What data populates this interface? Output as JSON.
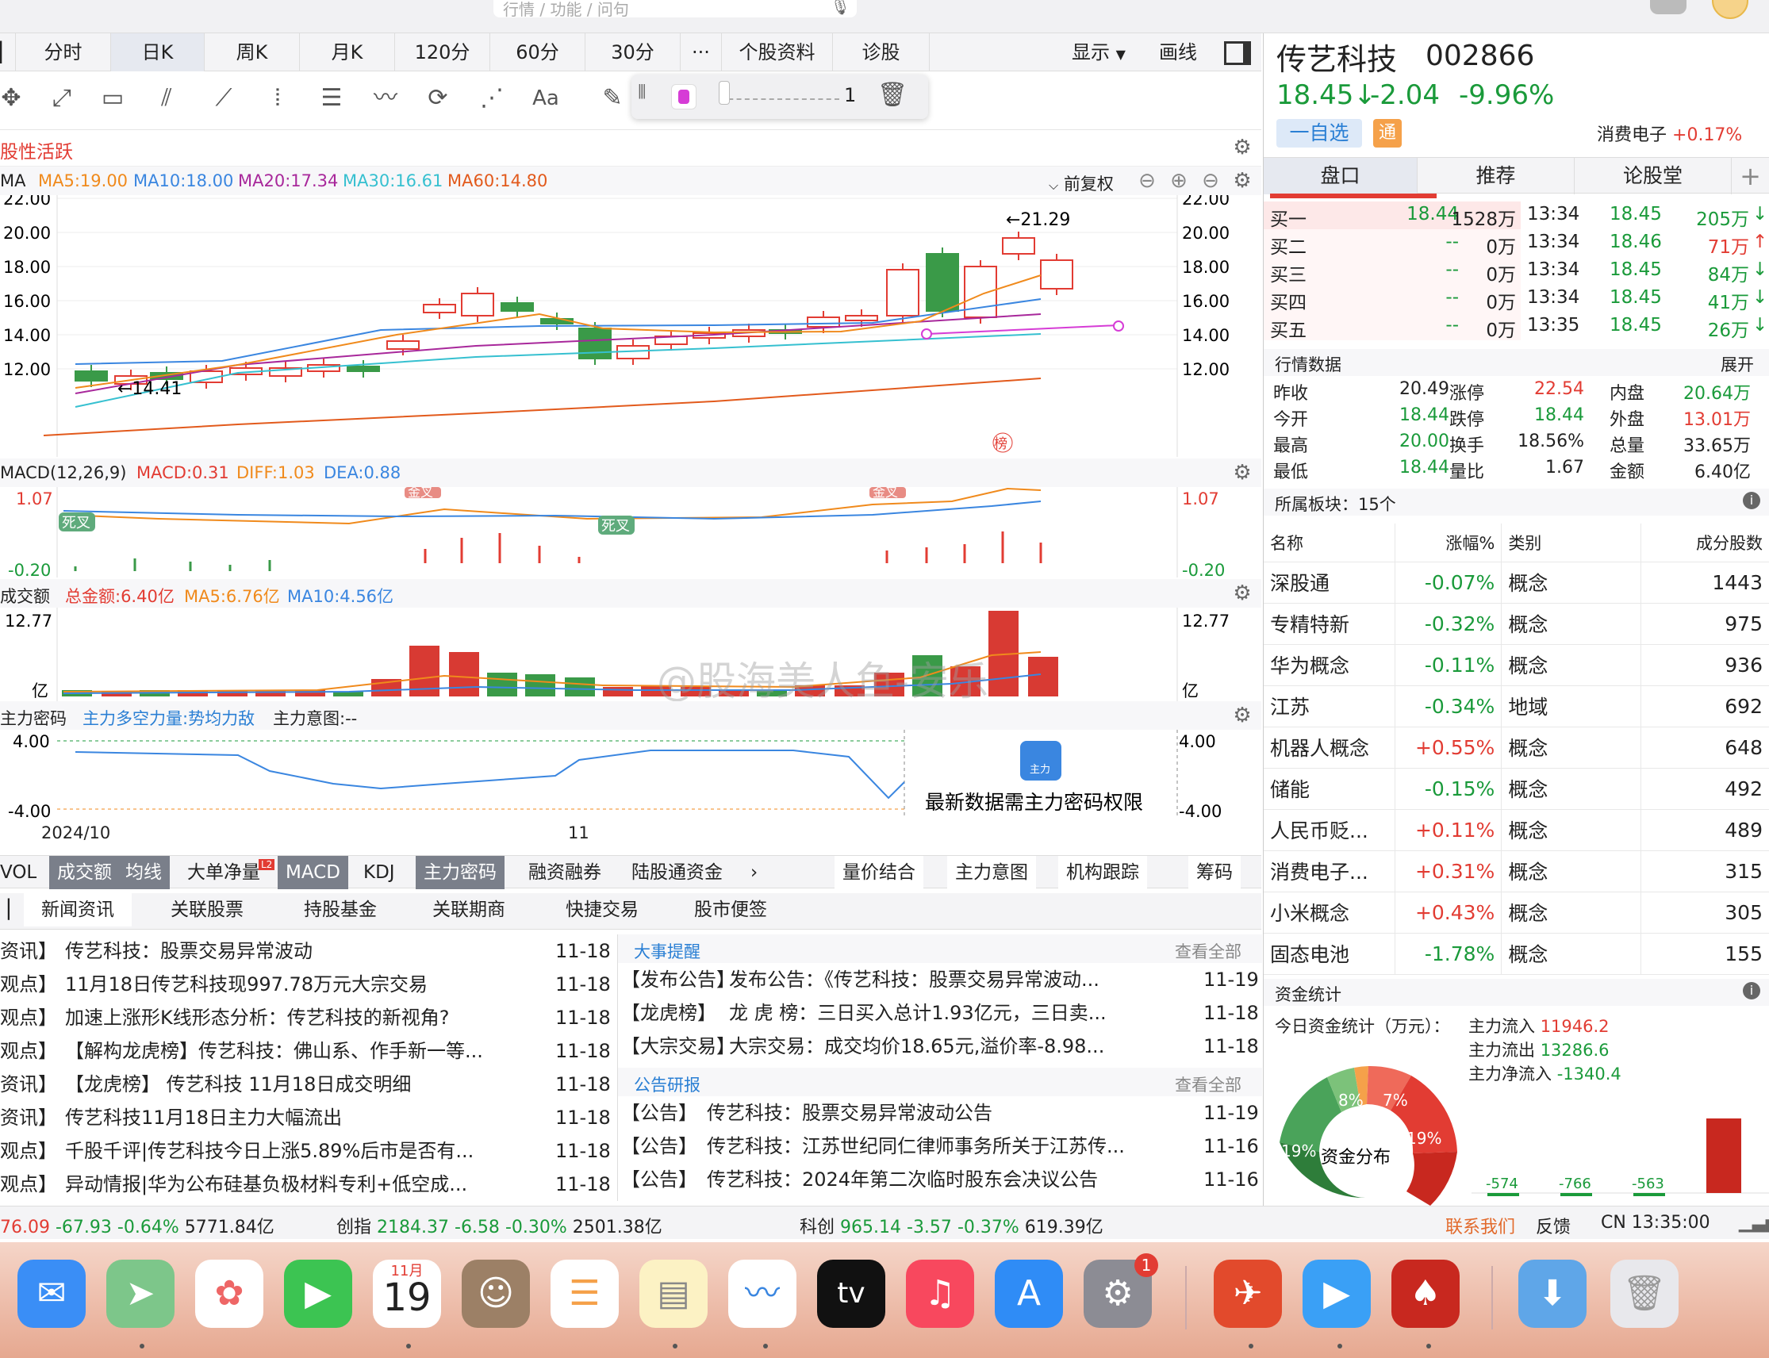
{
  "search": {
    "placeholder": "行情 / 功能 / 问句"
  },
  "tabs": [
    "分时",
    "日K",
    "周K",
    "月K",
    "120分",
    "60分",
    "30分",
    "···",
    "个股资料",
    "诊股"
  ],
  "display_label": "显示",
  "draw_label": "画线",
  "tool_slider_value": "1",
  "panel_title": "股性活跃",
  "ma": {
    "label": "MA",
    "ma5": "MA5:19.00",
    "ma10": "MA10:18.00",
    "ma20": "MA20:17.34",
    "ma30": "MA30:16.61",
    "ma60": "MA60:14.80",
    "adjust": "前复权"
  },
  "price_axis": [
    "22.00",
    "20.00",
    "18.00",
    "16.00",
    "14.00",
    "12.00"
  ],
  "high_label": "←21.29",
  "low_label": "←14.41",
  "bang": "榜",
  "macd": {
    "title": "MACD(12,26,9)",
    "macd": "MACD:0.31",
    "diff": "DIFF:1.03",
    "dea": "DEA:0.88",
    "top": "1.07",
    "bottom": "-0.20",
    "dead_cross": "死叉",
    "gold_cross": "金叉"
  },
  "vol": {
    "title": "成交额",
    "total": "总金额:6.40亿",
    "ma5": "MA5:6.76亿",
    "ma10": "MA10:4.56亿",
    "top": "12.77",
    "unit": "亿"
  },
  "mfc": {
    "title": "主力密码",
    "power": "主力多空力量:势均力敌",
    "intent": "主力意图:--",
    "top": "4.00",
    "bottom": "-4.00",
    "lock_msg": "最新数据需主力密码权限",
    "lock_tag": "主力"
  },
  "dates": [
    "2024/10",
    "11"
  ],
  "watermark": "@股海美人鱼-安乐",
  "indicator_tabs": [
    "VOL",
    "成交额",
    "均线",
    "大单净量",
    "MACD",
    "KDJ",
    "主力密码",
    "融资融券",
    "陆股通资金"
  ],
  "indicator_right": [
    "量价结合",
    "主力意图",
    "机构跟踪",
    "筹码"
  ],
  "l2": "L2",
  "news_tabs": [
    "新闻资讯",
    "关联股票",
    "持股基金",
    "关联期商",
    "快捷交易",
    "股市便签"
  ],
  "news": [
    {
      "tag": "资讯】",
      "title": "传艺科技：股票交易异常波动",
      "date": "11-18"
    },
    {
      "tag": "观点】",
      "title": "11月18日传艺科技现997.78万元大宗交易",
      "date": "11-18"
    },
    {
      "tag": "观点】",
      "title": "加速上涨形K线形态分析：传艺科技的新视角?",
      "date": "11-18"
    },
    {
      "tag": "观点】",
      "title": "【解构龙虎榜】传艺科技：佛山系、作手新一等...",
      "date": "11-18"
    },
    {
      "tag": "资讯】",
      "title": "【龙虎榜】 传艺科技 11月18日成交明细",
      "date": "11-18"
    },
    {
      "tag": "资讯】",
      "title": "传艺科技11月18日主力大幅流出",
      "date": "11-18"
    },
    {
      "tag": "观点】",
      "title": "千股千评|传艺科技今日上涨5.89%后市是否有...",
      "date": "11-18"
    },
    {
      "tag": "观点】",
      "title": "异动情报|华为公布硅基负极材料专利+低空成...",
      "date": "11-18"
    }
  ],
  "events": {
    "title": "大事提醒",
    "more": "查看全部",
    "items": [
      {
        "tag": "【发布公告】",
        "title": "发布公告：《传艺科技：股票交易异常波动...",
        "date": "11-19"
      },
      {
        "tag": "【龙虎榜】",
        "title": "龙 虎 榜：三日买入总计1.93亿元，三日卖...",
        "date": "11-18"
      },
      {
        "tag": "【大宗交易】",
        "title": "大宗交易：成交均价18.65元,溢价率-8.98...",
        "date": "11-18"
      }
    ]
  },
  "reports": {
    "title": "公告研报",
    "more": "查看全部",
    "items": [
      {
        "tag": "【公告】",
        "title": "传艺科技：股票交易异常波动公告",
        "date": "11-19"
      },
      {
        "tag": "【公告】",
        "title": "传艺科技：江苏世纪同仁律师事务所关于江苏传...",
        "date": "11-16"
      },
      {
        "tag": "【公告】",
        "title": "传艺科技：2024年第二次临时股东会决议公告",
        "date": "11-16"
      }
    ]
  },
  "stock": {
    "name": "传艺科技",
    "code": "002866",
    "price": "18.45↓",
    "change": "-2.04",
    "pct": "-9.96%",
    "watch_btn": "一自选",
    "tong": "通",
    "sector": "消费电子",
    "sector_pct": "+0.17%"
  },
  "rtabs": [
    "盘口",
    "推荐",
    "论股堂"
  ],
  "bids": [
    {
      "name": "买一",
      "price": "18.44",
      "vol": "1528万"
    },
    {
      "name": "买二",
      "price": "--",
      "vol": "0万"
    },
    {
      "name": "买三",
      "price": "--",
      "vol": "0万"
    },
    {
      "name": "买四",
      "price": "--",
      "vol": "0万"
    },
    {
      "name": "买五",
      "price": "--",
      "vol": "0万"
    }
  ],
  "ticks": [
    {
      "time": "13:34",
      "price": "18.45",
      "vol": "205万",
      "dir": "↓"
    },
    {
      "time": "13:34",
      "price": "18.46",
      "vol": "71万",
      "dir": "↑"
    },
    {
      "time": "13:34",
      "price": "18.45",
      "vol": "84万",
      "dir": "↓"
    },
    {
      "time": "13:34",
      "price": "18.45",
      "vol": "41万",
      "dir": "↓"
    },
    {
      "time": "13:35",
      "price": "18.45",
      "vol": "26万",
      "dir": "↓"
    }
  ],
  "market": {
    "title": "行情数据",
    "expand": "展开",
    "rows": [
      [
        "昨收",
        "20.49",
        "涨停",
        "22.54",
        "内盘",
        "20.64万"
      ],
      [
        "今开",
        "18.44",
        "跌停",
        "18.44",
        "外盘",
        "13.01万"
      ],
      [
        "最高",
        "20.00",
        "换手",
        "18.56%",
        "总量",
        "33.65万"
      ],
      [
        "最低",
        "18.44",
        "量比",
        "1.67",
        "金额",
        "6.40亿"
      ]
    ]
  },
  "blocks": {
    "title": "所属板块：15个",
    "headers": [
      "名称",
      "涨幅%",
      "类别",
      "成分股数"
    ],
    "rows": [
      [
        "深股通",
        "-0.07%",
        "概念",
        "1443"
      ],
      [
        "专精特新",
        "-0.32%",
        "概念",
        "975"
      ],
      [
        "华为概念",
        "-0.11%",
        "概念",
        "936"
      ],
      [
        "江苏",
        "-0.34%",
        "地域",
        "692"
      ],
      [
        "机器人概念",
        "+0.55%",
        "概念",
        "648"
      ],
      [
        "储能",
        "-0.15%",
        "概念",
        "492"
      ],
      [
        "人民币贬...",
        "+0.11%",
        "概念",
        "489"
      ],
      [
        "消费电子...",
        "+0.31%",
        "概念",
        "315"
      ],
      [
        "小米概念",
        "+0.43%",
        "概念",
        "305"
      ],
      [
        "固态电池",
        "-1.78%",
        "概念",
        "155"
      ]
    ]
  },
  "funds": {
    "title": "资金统计",
    "label": "今日资金统计（万元）：",
    "inflow_label": "主力流入",
    "inflow": "11946.2",
    "outflow_label": "主力流出",
    "outflow": "13286.6",
    "net_label": "主力净流入",
    "net": "-1340.4",
    "donut_center": "资金分布",
    "pcts": [
      "8%",
      "7%",
      "19%",
      "19%"
    ],
    "bars": [
      "-574",
      "-766",
      "-563"
    ]
  },
  "statusbar": {
    "idx1": "76.09",
    "idx1_chg": "-67.93",
    "idx1_pct": "-0.64%",
    "idx1_amt": "5771.84亿",
    "cy": "创指",
    "cy_val": "2184.37",
    "cy_chg": "-6.58",
    "cy_pct": "-0.30%",
    "cy_amt": "2501.38亿",
    "kc": "科创",
    "kc_val": "965.14",
    "kc_chg": "-3.57",
    "kc_pct": "-0.37%",
    "kc_amt": "619.39亿",
    "contact": "联系我们",
    "feedback": "反馈",
    "clock": "CN 13:35:00"
  },
  "dock": {
    "calendar_month": "11月",
    "calendar_day": "19",
    "settings_badge": "1",
    "tv": "tv"
  }
}
